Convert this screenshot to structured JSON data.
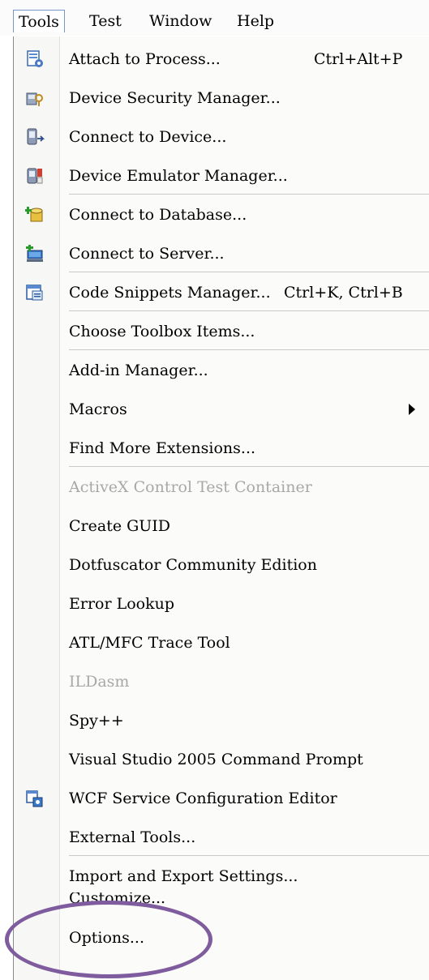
{
  "menubar": {
    "items": [
      {
        "label": "Tools",
        "active": true
      },
      {
        "label": "Test",
        "active": false
      },
      {
        "label": "Window",
        "active": false
      },
      {
        "label": "Help",
        "active": false
      }
    ]
  },
  "menu": {
    "items": [
      {
        "label": "Attach to Process...",
        "shortcut": "Ctrl+Alt+P",
        "icon": "attach-process-icon"
      },
      {
        "label": "Device Security Manager...",
        "icon": "device-security-icon"
      },
      {
        "label": "Connect to Device...",
        "icon": "connect-device-icon"
      },
      {
        "label": "Device Emulator Manager...",
        "icon": "device-emulator-icon"
      },
      {
        "label": "Connect to Database...",
        "icon": "connect-database-icon"
      },
      {
        "label": "Connect to Server...",
        "icon": "connect-server-icon"
      },
      {
        "label": "Code Snippets Manager...",
        "shortcut": "Ctrl+K, Ctrl+B",
        "icon": "code-snippets-icon"
      },
      {
        "label": "Choose Toolbox Items..."
      },
      {
        "label": "Add-in Manager..."
      },
      {
        "label": "Macros",
        "submenu": true
      },
      {
        "label": "Find More Extensions..."
      },
      {
        "label": "ActiveX Control Test Container",
        "disabled": true
      },
      {
        "label": "Create GUID"
      },
      {
        "label": "Dotfuscator Community Edition"
      },
      {
        "label": "Error Lookup"
      },
      {
        "label": "ATL/MFC Trace Tool"
      },
      {
        "label": "ILDasm",
        "disabled": true
      },
      {
        "label": "Spy++"
      },
      {
        "label": "Visual Studio 2005 Command Prompt"
      },
      {
        "label": "WCF Service Configuration Editor",
        "icon": "wcf-config-icon"
      },
      {
        "label": "External Tools..."
      },
      {
        "label": "Import and Export Settings..."
      },
      {
        "label": "Customize..."
      },
      {
        "label": "Options..."
      }
    ]
  },
  "colors": {
    "highlight_ellipse": "#7e5c9e",
    "disabled_text": "#a8a8a8",
    "menubar_active_border": "#7a96c8"
  }
}
